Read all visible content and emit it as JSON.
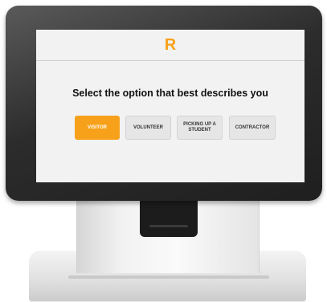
{
  "kiosk": {
    "logo_text": "R",
    "prompt": "Select the option that best describes you",
    "options": [
      {
        "label": "VISITOR",
        "selected": true
      },
      {
        "label": "VOLUNTEER",
        "selected": false
      },
      {
        "label": "PICKING UP A STUDENT",
        "selected": false
      },
      {
        "label": "CONTRACTOR",
        "selected": false
      }
    ]
  },
  "colors": {
    "accent": "#f7a11a",
    "screen_bg": "#f2f2f2",
    "option_bg": "#e6e6e6",
    "bezel": "#2c2c2c"
  }
}
